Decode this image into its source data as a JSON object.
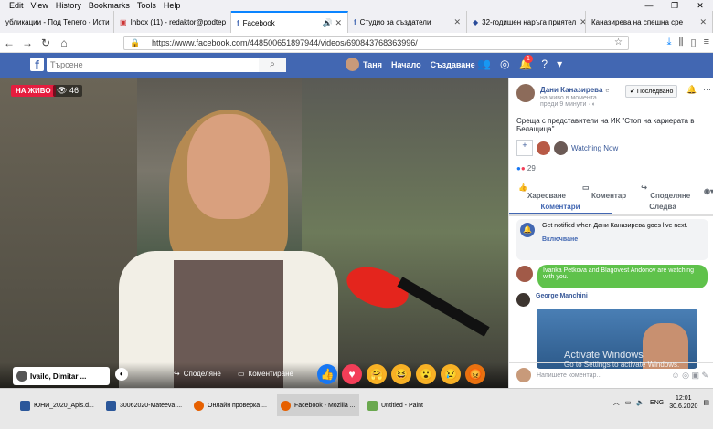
{
  "menubar": {
    "items": [
      "Edit",
      "View",
      "History",
      "Bookmarks",
      "Tools",
      "Help"
    ]
  },
  "tabs": [
    {
      "label": "убликации - Под Тепето - Исти"
    },
    {
      "label": "Inbox (11) - redaktor@podtep"
    },
    {
      "label": "Facebook",
      "active": true
    },
    {
      "label": "Студио за създатели"
    },
    {
      "label": "32-годишен наръга приятел"
    },
    {
      "label": "Каназирева на спешна сре"
    }
  ],
  "url": "https://www.facebook.com/448500651897944/videos/690843768363996/",
  "fb": {
    "search_placeholder": "Търсене",
    "user": "Таня",
    "home": "Начало",
    "create": "Създаване",
    "notif_count": "1"
  },
  "video": {
    "live_label": "НА ЖИВО",
    "viewers": "46",
    "commenters_chip": "Ivailo, Dimitar ...",
    "share_label": "Споделяне",
    "comment_label": "Коментиране"
  },
  "side": {
    "author_name": "Дани Каназирева",
    "author_status_suffix": "е",
    "author_sub": "на живо в момента.",
    "time": "преди 9 минути",
    "follow_label": "Последвано",
    "description": "Среща с представители на ИК \"Стоп на кариерата в Белащица\"",
    "watching_now": "Watching Now",
    "reaction_count": "29",
    "actions": [
      "Харесване",
      "Коментар",
      "Споделяне"
    ],
    "tabs": [
      "Коментари",
      "Следва"
    ],
    "notify_text": "Get notified when Дани Каназирева goes live next.",
    "notify_sub": "Включване",
    "green_msg": "Ivanka Petkova and Blagovest Andonov are watching with you.",
    "george": "George Manchini",
    "comment_placeholder": "Напишете коментар..."
  },
  "watermark": {
    "title": "Activate Windows",
    "sub": "Go to Settings to activate Windows."
  },
  "taskbar": {
    "items": [
      "ЮНИ_2020_Apis.d...",
      "30062020-Mateeva....",
      "Онлайн проверка ...",
      "Facebook - Mozilla ...",
      "Untitled - Paint"
    ],
    "lang": "ENG",
    "time": "12:01",
    "date": "30.6.2020"
  },
  "colors": {
    "fb_blue": "#4267b2",
    "live_red": "#e41e3f",
    "green": "#5fc24b"
  }
}
